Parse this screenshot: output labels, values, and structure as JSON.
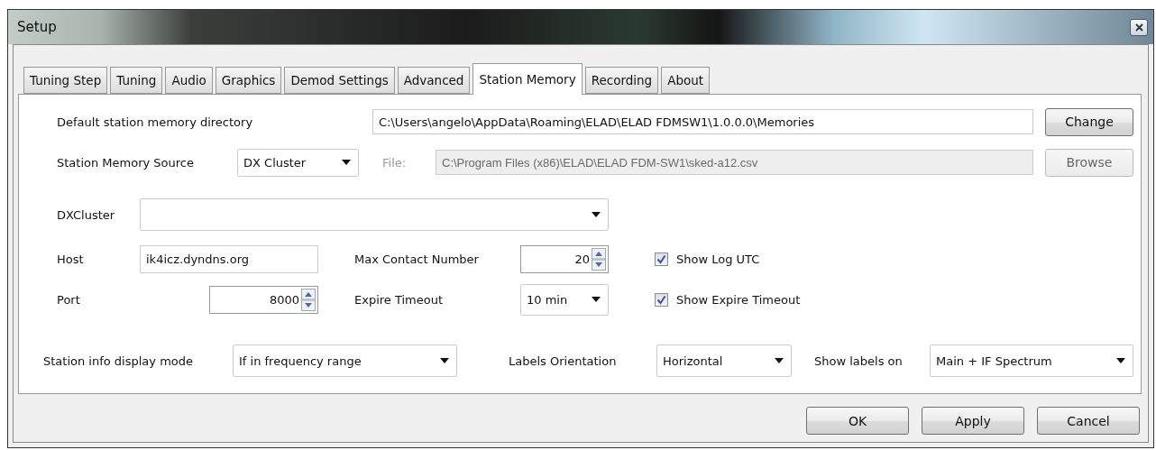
{
  "window": {
    "title": "Setup"
  },
  "tabs": [
    {
      "label": "Tuning Step",
      "selected": false
    },
    {
      "label": "Tuning",
      "selected": false
    },
    {
      "label": "Audio",
      "selected": false
    },
    {
      "label": "Graphics",
      "selected": false
    },
    {
      "label": "Demod Settings",
      "selected": false
    },
    {
      "label": "Advanced",
      "selected": false
    },
    {
      "label": "Station Memory",
      "selected": true
    },
    {
      "label": "Recording",
      "selected": false
    },
    {
      "label": "About",
      "selected": false
    }
  ],
  "directory": {
    "label": "Default station memory directory",
    "value": "C:\\Users\\angelo\\AppData\\Roaming\\ELAD\\ELAD FDMSW1\\1.0.0.0\\Memories",
    "button": "Change"
  },
  "source": {
    "label": "Station Memory Source",
    "value": "DX Cluster"
  },
  "file": {
    "label": "File:",
    "value": "C:\\Program Files (x86)\\ELAD\\ELAD FDM-SW1\\sked-a12.csv",
    "button": "Browse",
    "disabled": true
  },
  "dxcluster": {
    "label": "DXCluster"
  },
  "host": {
    "label": "Host",
    "value": "ik4icz.dyndns.org"
  },
  "port": {
    "label": "Port",
    "value": "8000"
  },
  "max_contact": {
    "label": "Max Contact Number",
    "value": "20"
  },
  "expire_timeout": {
    "label": "Expire Timeout",
    "value": "10 min"
  },
  "checkboxes": [
    {
      "label": "Show Log UTC",
      "checked": true
    },
    {
      "label": "Show Expire Timeout",
      "checked": true
    }
  ],
  "display_mode": {
    "label": "Station info display mode",
    "value": "If in frequency range"
  },
  "labels_orientation": {
    "label": "Labels Orientation",
    "value": "Horizontal"
  },
  "show_labels_on": {
    "label": "Show labels on",
    "value": "Main + IF Spectrum"
  },
  "buttons": [
    "OK",
    "Apply",
    "Cancel"
  ]
}
